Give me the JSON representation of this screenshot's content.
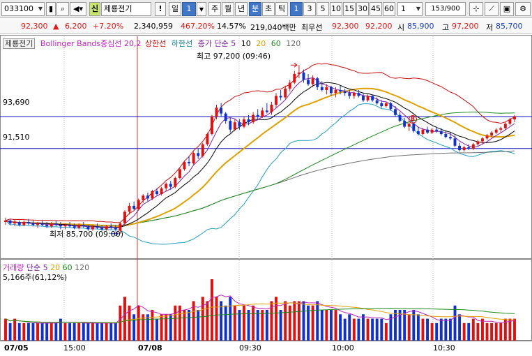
{
  "toolbar": {
    "code": "033100",
    "market_badge": "신",
    "stock_name": "제룡전기",
    "warning": "!",
    "period_label": "일",
    "period_num": "1",
    "week": "주",
    "month": "월",
    "year": "년",
    "minute": "분",
    "second": "초",
    "tick": "틱",
    "intervals": [
      "1",
      "3",
      "5",
      "10",
      "15",
      "30",
      "45",
      "60"
    ],
    "interval_input": "1",
    "count": "153",
    "count_max": "/900"
  },
  "quote": {
    "price": "92,300",
    "change_arrow": "▲",
    "change": "6,200",
    "change_pct": "+7.20%",
    "volume": "2,340,959",
    "volume_ratio": "467.20%",
    "turnover": "14.57%",
    "amount": "219,040백만",
    "best_label": "최우선",
    "ask": "92,300",
    "bid": "92,200",
    "open_label": "시",
    "open": "85,900",
    "high_label": "고",
    "high": "97,200",
    "low_label": "저",
    "low": "85,700"
  },
  "legend": {
    "title": "제룡전기",
    "bb": "Bollinger Bands중심선 20,2",
    "upper": "상한선",
    "lower": "하한선",
    "ma_label": "종가 단순 5",
    "ma10": "10",
    "ma20": "20",
    "ma60": "60",
    "ma120": "120"
  },
  "volume_legend": {
    "title": "거래량",
    "ma_label": "단순 5",
    "ma20": "20",
    "ma60": "60",
    "ma120": "120",
    "sub": "5,166주(61,12%)"
  },
  "price_lines": {
    "line1": "93,690",
    "line2": "91,510"
  },
  "annotations": {
    "high": "최고 97,200 (09:46)",
    "low": "최저 85,700 (09:00)",
    "signal": "B"
  },
  "xaxis": [
    "07/05",
    "15:00",
    "07/08",
    "09:30",
    "10:00",
    "10:30"
  ],
  "chart_data": {
    "type": "candlestick",
    "price_ylim": [
      84500,
      98500
    ],
    "reference_lines": [
      93690,
      91510
    ],
    "high": 97200,
    "low": 85700,
    "candles": [
      [
        86500,
        86800,
        86300,
        86600
      ],
      [
        86600,
        86700,
        86300,
        86400
      ],
      [
        86400,
        86700,
        86200,
        86500
      ],
      [
        86500,
        86600,
        86200,
        86300
      ],
      [
        86300,
        86600,
        86200,
        86500
      ],
      [
        86500,
        86700,
        86300,
        86400
      ],
      [
        86400,
        86600,
        86200,
        86300
      ],
      [
        86300,
        86500,
        86100,
        86400
      ],
      [
        86400,
        86600,
        86200,
        86300
      ],
      [
        86300,
        86500,
        86100,
        86200
      ],
      [
        86200,
        86500,
        86100,
        86400
      ],
      [
        86400,
        86600,
        86200,
        86300
      ],
      [
        86300,
        86500,
        86000,
        86200
      ],
      [
        86200,
        86400,
        86000,
        86300
      ],
      [
        86300,
        86500,
        86100,
        86200
      ],
      [
        86200,
        86400,
        86000,
        86100
      ],
      [
        86100,
        86400,
        86000,
        86300
      ],
      [
        86300,
        86500,
        86100,
        86200
      ],
      [
        86200,
        86300,
        85900,
        86000
      ],
      [
        86000,
        86300,
        85900,
        86200
      ],
      [
        86200,
        86400,
        86000,
        86100
      ],
      [
        86100,
        86300,
        85900,
        86000
      ],
      [
        86000,
        86300,
        85900,
        86200
      ],
      [
        86200,
        86400,
        86000,
        86100
      ],
      [
        86100,
        86300,
        85900,
        86000
      ],
      [
        85900,
        86500,
        85700,
        86400
      ],
      [
        86400,
        87300,
        86300,
        87200
      ],
      [
        87200,
        87800,
        87000,
        87600
      ],
      [
        87600,
        87900,
        87300,
        87400
      ],
      [
        87400,
        88100,
        87300,
        88000
      ],
      [
        88000,
        88400,
        87800,
        88300
      ],
      [
        88300,
        88500,
        87900,
        88100
      ],
      [
        88100,
        88700,
        88000,
        88600
      ],
      [
        88600,
        88800,
        88300,
        88400
      ],
      [
        88400,
        88900,
        88300,
        88800
      ],
      [
        88800,
        89200,
        88600,
        89100
      ],
      [
        89100,
        89300,
        88700,
        88900
      ],
      [
        88900,
        89600,
        88800,
        89500
      ],
      [
        89500,
        90200,
        89400,
        90100
      ],
      [
        90100,
        90700,
        90000,
        90600
      ],
      [
        90600,
        91000,
        90300,
        90500
      ],
      [
        90500,
        91300,
        90400,
        91200
      ],
      [
        91200,
        91500,
        90800,
        91000
      ],
      [
        91000,
        91900,
        90900,
        91800
      ],
      [
        91800,
        92600,
        91700,
        92500
      ],
      [
        92500,
        93800,
        92400,
        93700
      ],
      [
        93700,
        94500,
        93500,
        94300
      ],
      [
        94300,
        94600,
        93700,
        93900
      ],
      [
        93900,
        94000,
        93200,
        93400
      ],
      [
        93400,
        93600,
        92600,
        92800
      ],
      [
        92800,
        93500,
        92700,
        93300
      ],
      [
        93300,
        93500,
        92800,
        93000
      ],
      [
        93000,
        93700,
        92900,
        93500
      ],
      [
        93500,
        93800,
        93100,
        93300
      ],
      [
        93300,
        94000,
        93200,
        93800
      ],
      [
        93800,
        94200,
        93500,
        93700
      ],
      [
        93700,
        94300,
        93600,
        94100
      ],
      [
        94100,
        94600,
        93900,
        94000
      ],
      [
        94000,
        94700,
        93800,
        94500
      ],
      [
        94500,
        95300,
        94300,
        95100
      ],
      [
        95100,
        95500,
        94800,
        95000
      ],
      [
        95000,
        95800,
        94900,
        95600
      ],
      [
        95600,
        96200,
        95400,
        96000
      ],
      [
        96000,
        96800,
        95900,
        96600
      ],
      [
        96600,
        97200,
        96300,
        96700
      ],
      [
        96700,
        96900,
        96000,
        96200
      ],
      [
        96200,
        96600,
        95800,
        95900
      ],
      [
        95900,
        96500,
        95700,
        96300
      ],
      [
        96300,
        96400,
        95500,
        95700
      ],
      [
        95700,
        96100,
        95400,
        95500
      ],
      [
        95500,
        95900,
        95200,
        95700
      ],
      [
        95700,
        95800,
        95100,
        95300
      ],
      [
        95300,
        95700,
        95000,
        95500
      ],
      [
        95500,
        95800,
        95200,
        95400
      ],
      [
        95400,
        95600,
        95100,
        95300
      ],
      [
        95300,
        95500,
        94900,
        95100
      ],
      [
        95100,
        95400,
        94900,
        95300
      ],
      [
        95300,
        95500,
        95000,
        95100
      ],
      [
        95100,
        95300,
        94700,
        94800
      ],
      [
        94800,
        95200,
        94700,
        95100
      ],
      [
        95100,
        95200,
        94700,
        94800
      ],
      [
        94800,
        95000,
        94500,
        94600
      ],
      [
        94600,
        94800,
        94300,
        94400
      ],
      [
        94400,
        94700,
        94300,
        94600
      ],
      [
        94600,
        94700,
        94100,
        94200
      ],
      [
        94200,
        94400,
        93700,
        93800
      ],
      [
        93800,
        94000,
        93300,
        93400
      ],
      [
        93400,
        93600,
        92900,
        93000
      ],
      [
        93000,
        93300,
        92700,
        93200
      ],
      [
        93200,
        93300,
        92600,
        92700
      ],
      [
        92700,
        93000,
        92400,
        92500
      ],
      [
        92500,
        92900,
        92400,
        92800
      ],
      [
        92800,
        93000,
        92500,
        92600
      ],
      [
        92600,
        92900,
        92500,
        92800
      ],
      [
        92800,
        93000,
        92600,
        92700
      ],
      [
        92700,
        92900,
        92400,
        92500
      ],
      [
        92500,
        92700,
        92200,
        92300
      ],
      [
        92300,
        92600,
        92100,
        92200
      ],
      [
        92200,
        92400,
        91600,
        91700
      ],
      [
        91700,
        91900,
        91300,
        91400
      ],
      [
        91400,
        91700,
        91300,
        91600
      ],
      [
        91600,
        91800,
        91400,
        91500
      ],
      [
        91500,
        91900,
        91400,
        91800
      ],
      [
        91800,
        92100,
        91700,
        92000
      ],
      [
        92000,
        92300,
        91800,
        92200
      ],
      [
        92200,
        92500,
        92100,
        92400
      ],
      [
        92400,
        92700,
        92300,
        92600
      ],
      [
        92600,
        92900,
        92500,
        92800
      ],
      [
        92800,
        93000,
        92600,
        92900
      ],
      [
        92900,
        93300,
        92800,
        93200
      ],
      [
        93200,
        93600,
        93100,
        93500
      ],
      [
        93500,
        93800,
        93300,
        93700
      ]
    ]
  }
}
